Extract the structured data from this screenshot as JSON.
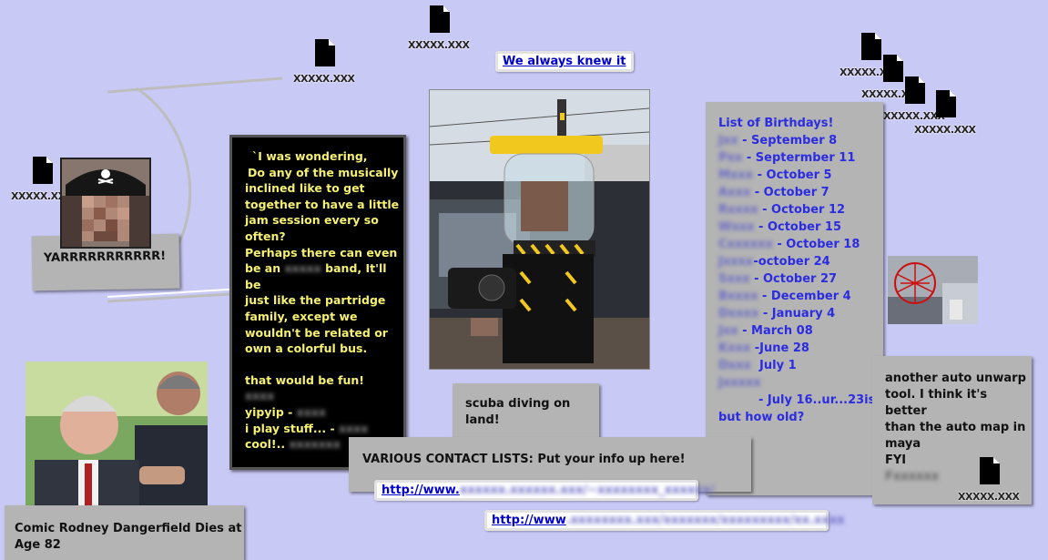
{
  "icon_label": "XXXXX.XXX",
  "colors": {
    "background": "#c9c9f6",
    "note_gray": "#b4b4b4",
    "link_blue": "#0000cc",
    "birthday_blue": "#2c2ce0",
    "black_note_text": "#f5f071"
  },
  "link_top": "We always knew it",
  "pirate": {
    "caption": "YARRRRRRRRRRR!"
  },
  "black_note": {
    "lines": [
      "`I was wondering,",
      "Do any of the musically",
      "inclined like to get",
      "together to have a little",
      "jam session every so",
      "often?",
      "Perhaps there can even",
      "be an",
      "band, It'll be",
      "just like the partridge",
      "family, except we",
      "wouldn't be related or",
      "own a colorful bus.",
      "that would be fun!",
      "yipyip -",
      "i play stuff... -",
      "cool!.."
    ]
  },
  "scuba": {
    "caption": "scuba diving on land!"
  },
  "birthdays": {
    "title": "List of Birthdays!",
    "entries": [
      "- September 8",
      "- Septermber 11",
      "- October 5",
      "- October 7",
      "- October 12",
      "- October 15",
      "- October 18",
      "-october 24",
      "- October 27",
      "- December 4",
      "- January 4",
      "- March 08",
      "-June 28",
      "July 1",
      "- July 16..ur...23ish",
      "but how old?"
    ]
  },
  "unwrap": {
    "lines": [
      "another auto unwarp",
      "tool. I think it's better",
      "than the auto map in",
      "maya",
      "FYI"
    ]
  },
  "rodney": {
    "caption_line1": "Comic Rodney Dangerfield Dies at",
    "caption_line2": "Age 82"
  },
  "contact": {
    "title": "VARIOUS CONTACT LISTS: Put your info up here!",
    "link1_prefix": "http://www.",
    "link2_prefix": "http://www"
  }
}
